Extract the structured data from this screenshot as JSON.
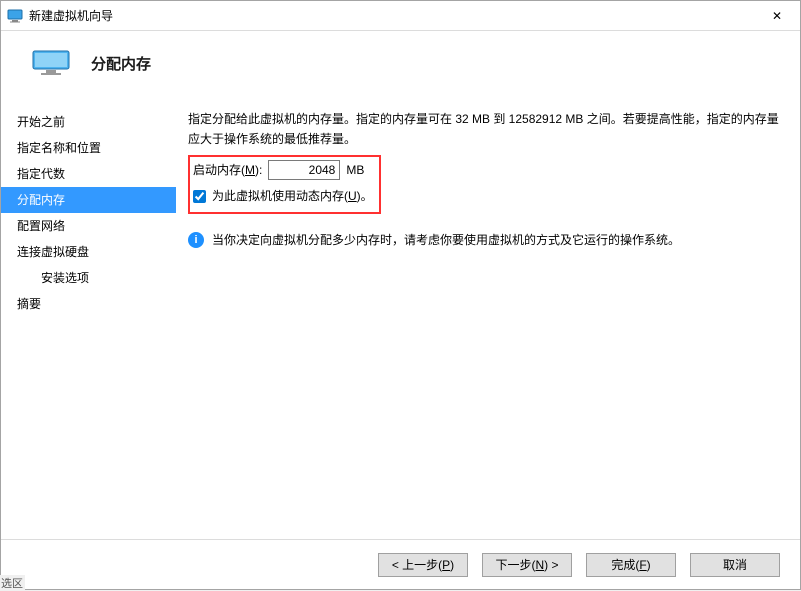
{
  "window": {
    "title": "新建虚拟机向导",
    "close_glyph": "✕"
  },
  "header": {
    "title": "分配内存"
  },
  "sidebar": {
    "items": [
      {
        "label": "开始之前",
        "active": false,
        "indent": false
      },
      {
        "label": "指定名称和位置",
        "active": false,
        "indent": false
      },
      {
        "label": "指定代数",
        "active": false,
        "indent": false
      },
      {
        "label": "分配内存",
        "active": true,
        "indent": false
      },
      {
        "label": "配置网络",
        "active": false,
        "indent": false
      },
      {
        "label": "连接虚拟硬盘",
        "active": false,
        "indent": false
      },
      {
        "label": "安装选项",
        "active": false,
        "indent": true
      },
      {
        "label": "摘要",
        "active": false,
        "indent": false
      }
    ]
  },
  "content": {
    "description": "指定分配给此虚拟机的内存量。指定的内存量可在 32 MB 到 12582912 MB 之间。若要提高性能，指定的内存量应大于操作系统的最低推荐量。",
    "start_mem_label_pre": "启动内存(",
    "start_mem_hotkey": "M",
    "start_mem_label_post": "):",
    "start_mem_value": "2048",
    "start_mem_unit": "MB",
    "dynamic_checked": true,
    "dynamic_label_pre": "为此虚拟机使用动态内存(",
    "dynamic_hotkey": "U",
    "dynamic_label_post": ")。",
    "info_text": "当你决定向虚拟机分配多少内存时，请考虑你要使用虚拟机的方式及它运行的操作系统。"
  },
  "footer": {
    "prev_pre": "< 上一步(",
    "prev_hot": "P",
    "prev_post": ")",
    "next_pre": "下一步(",
    "next_hot": "N",
    "next_post": ") >",
    "finish_pre": "完成(",
    "finish_hot": "F",
    "finish_post": ")",
    "cancel": "取消"
  },
  "corner_text": "选区"
}
